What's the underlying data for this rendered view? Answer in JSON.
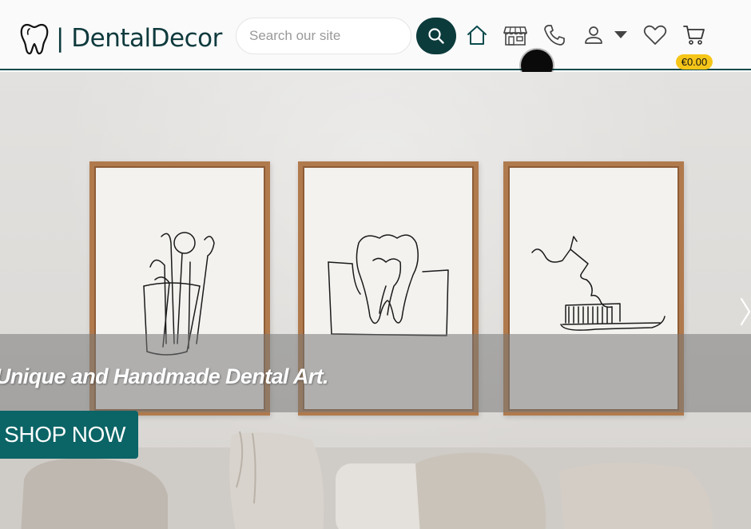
{
  "header": {
    "brand": "| DentalDecor",
    "search": {
      "placeholder": "Search our site"
    },
    "cart_total": "€0.00",
    "icons": [
      "tooth-icon",
      "search-icon",
      "home-icon",
      "store-icon",
      "phone-icon",
      "user-icon",
      "caret-down-icon",
      "heart-icon",
      "cart-icon"
    ]
  },
  "hero": {
    "tagline": "Unique and Handmade Dental Art.",
    "cta": "SHOP NOW"
  },
  "colors": {
    "brand_dark": "#0c3b3c",
    "cta_teal": "#0b6466",
    "badge_yellow": "#f5c518",
    "frame_wood": "#b07a4d"
  }
}
